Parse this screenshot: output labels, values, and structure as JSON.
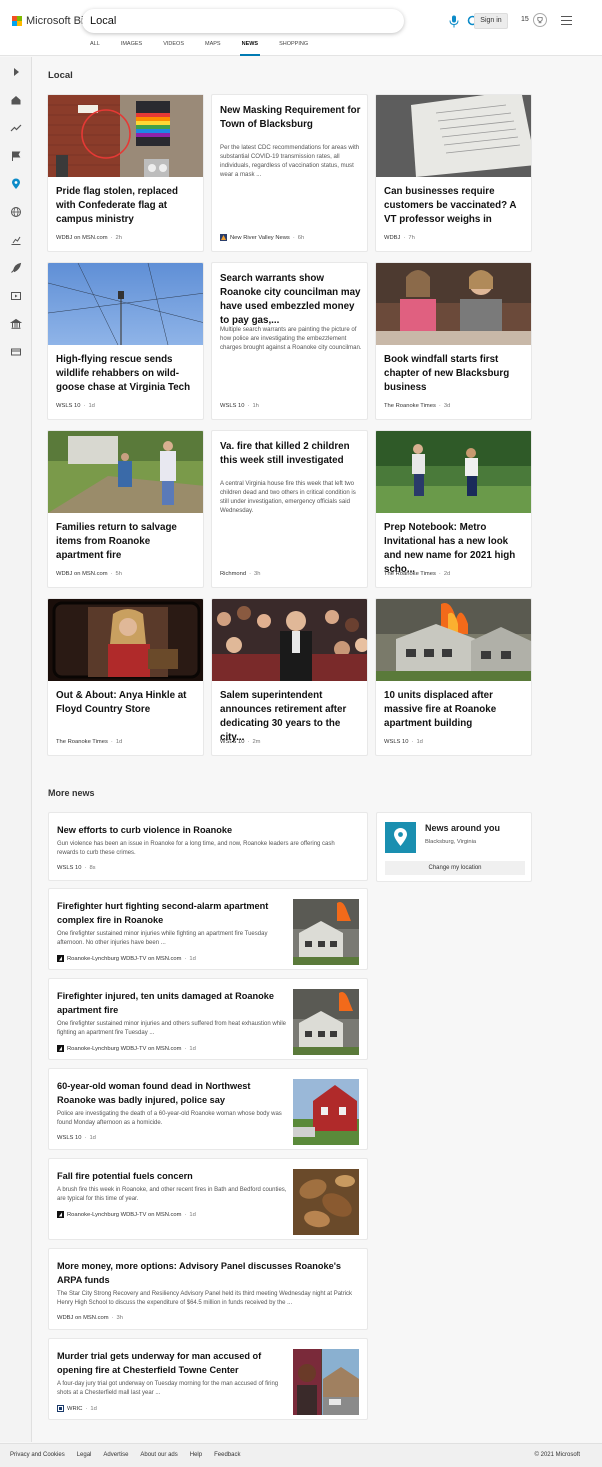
{
  "brand": {
    "name": "Microsoft Bing",
    "accent": "#007ab2"
  },
  "search": {
    "value": "Local"
  },
  "header": {
    "sign_in": "Sign in",
    "rewards_count": "15"
  },
  "tabs": [
    {
      "label": "ALL"
    },
    {
      "label": "IMAGES"
    },
    {
      "label": "VIDEOS"
    },
    {
      "label": "MAPS"
    },
    {
      "label": "NEWS",
      "active": true
    },
    {
      "label": "SHOPPING"
    }
  ],
  "sidebar": {
    "icons": [
      "expand-icon",
      "home-icon",
      "trending-icon",
      "flag-icon",
      "location-icon",
      "globe-icon",
      "chart-icon",
      "rocket-icon",
      "film-icon",
      "government-icon",
      "money-icon"
    ]
  },
  "section_title": "Local",
  "cards": [
    {
      "headline": "Pride flag stolen, replaced with Confederate flag at campus ministry",
      "snippet": "",
      "source": "WDBJ on MSN.com",
      "age": "2h"
    },
    {
      "headline": "New Masking Requirement for Town of Blacksburg",
      "snippet": "Per the latest CDC recommendations for areas with substantial COVID-19 transmission rates, all individuals, regardless of vaccination status, must wear a mask ...",
      "source": "New River Valley News",
      "age": "6h"
    },
    {
      "headline": "Can businesses require customers be vaccinated? A VT professor weighs in",
      "snippet": "",
      "source": "WDBJ",
      "age": "7h"
    },
    {
      "headline": "High-flying rescue sends wildlife rehabbers on wild-goose chase at Virginia Tech",
      "snippet": "",
      "source": "WSLS 10",
      "age": "1d"
    },
    {
      "headline": "Search warrants show Roanoke city councilman may have used embezzled money to pay gas,...",
      "snippet": "Multiple search warrants are painting the picture of how police are investigating the embezzlement charges brought against a Roanoke city councilman.",
      "source": "WSLS 10",
      "age": "1h"
    },
    {
      "headline": "Book windfall starts first chapter of new Blacksburg business",
      "snippet": "",
      "source": "The Roanoke Times",
      "age": "3d"
    },
    {
      "headline": "Families return to salvage items from Roanoke apartment fire",
      "snippet": "",
      "source": "WDBJ on MSN.com",
      "age": "5h"
    },
    {
      "headline": "Va. fire that killed 2 children this week still investigated",
      "snippet": "A central Virginia house fire this week that left two children dead and two others in critical condition is still under investigation, emergency officials said Wednesday.",
      "source": "Richmond",
      "age": "3h"
    },
    {
      "headline": "Prep Notebook: Metro Invitational has a new look and new name for 2021 high scho...",
      "snippet": "",
      "source": "The Roanoke Times",
      "age": "2d"
    },
    {
      "headline": "Out & About: Anya Hinkle at Floyd Country Store",
      "snippet": "",
      "source": "The Roanoke Times",
      "age": "1d"
    },
    {
      "headline": "Salem superintendent announces retirement after dedicating 30 years to the city...",
      "snippet": "",
      "source": "WSLS 10",
      "age": "2m"
    },
    {
      "headline": "10 units displaced after massive fire at Roanoke apartment building",
      "snippet": "",
      "source": "WSLS 10",
      "age": "1d"
    }
  ],
  "more_news_title": "More news",
  "more_news": [
    {
      "headline": "New efforts to curb violence in Roanoke",
      "snippet": "Gun violence has been an issue in Roanoke for a long time, and now, Roanoke leaders are offering cash rewards to curb these crimes.",
      "source": "WSLS 10",
      "age": "8s"
    },
    {
      "headline": "Firefighter hurt fighting second-alarm apartment complex fire in Roanoke",
      "snippet": "One firefighter sustained minor injuries while fighting an apartment fire Tuesday afternoon. No other injuries have been ...",
      "source": "Roanoke-Lynchburg WDBJ-TV on MSN.com",
      "age": "1d"
    },
    {
      "headline": "Firefighter injured, ten units damaged at Roanoke apartment fire",
      "snippet": "One firefighter sustained minor injuries and others suffered from heat exhaustion while fighting an apartment fire Tuesday ...",
      "source": "Roanoke-Lynchburg WDBJ-TV on MSN.com",
      "age": "1d"
    },
    {
      "headline": "60-year-old woman found dead in Northwest Roanoke was badly injured, police say",
      "snippet": "Police are investigating the death of a 60-year-old Roanoke woman whose body was found Monday afternoon as a homicide.",
      "source": "WSLS 10",
      "age": "1d"
    },
    {
      "headline": "Fall fire potential fuels concern",
      "snippet": "A brush fire this week in Roanoke, and other recent fires in Bath and Bedford counties, are typical for this time of year.",
      "source": "Roanoke-Lynchburg WDBJ-TV on MSN.com",
      "age": "1d"
    },
    {
      "headline": "More money, more options: Advisory Panel discusses Roanoke's ARPA funds",
      "snippet": "The Star City Strong Recovery and Resiliency Advisory Panel held its third meeting Wednesday night at Patrick Henry High School to discuss the expenditure of $64.5 million in funds received by the ...",
      "source": "WDBJ on MSN.com",
      "age": "3h"
    },
    {
      "headline": "Murder trial gets underway for man accused of opening fire at Chesterfield Towne Center",
      "snippet": "A four-day jury trial got underway on Tuesday morning for the man accused of firing shots at a Chesterfield mall last year ...",
      "source": "WRIC",
      "age": "1d"
    }
  ],
  "news_around_you": {
    "title": "News around you",
    "location": "Blacksburg, Virginia",
    "button": "Change my location"
  },
  "footer": {
    "links": [
      "Privacy and Cookies",
      "Legal",
      "Advertise",
      "About our ads",
      "Help",
      "Feedback"
    ],
    "copyright": "© 2021 Microsoft"
  }
}
